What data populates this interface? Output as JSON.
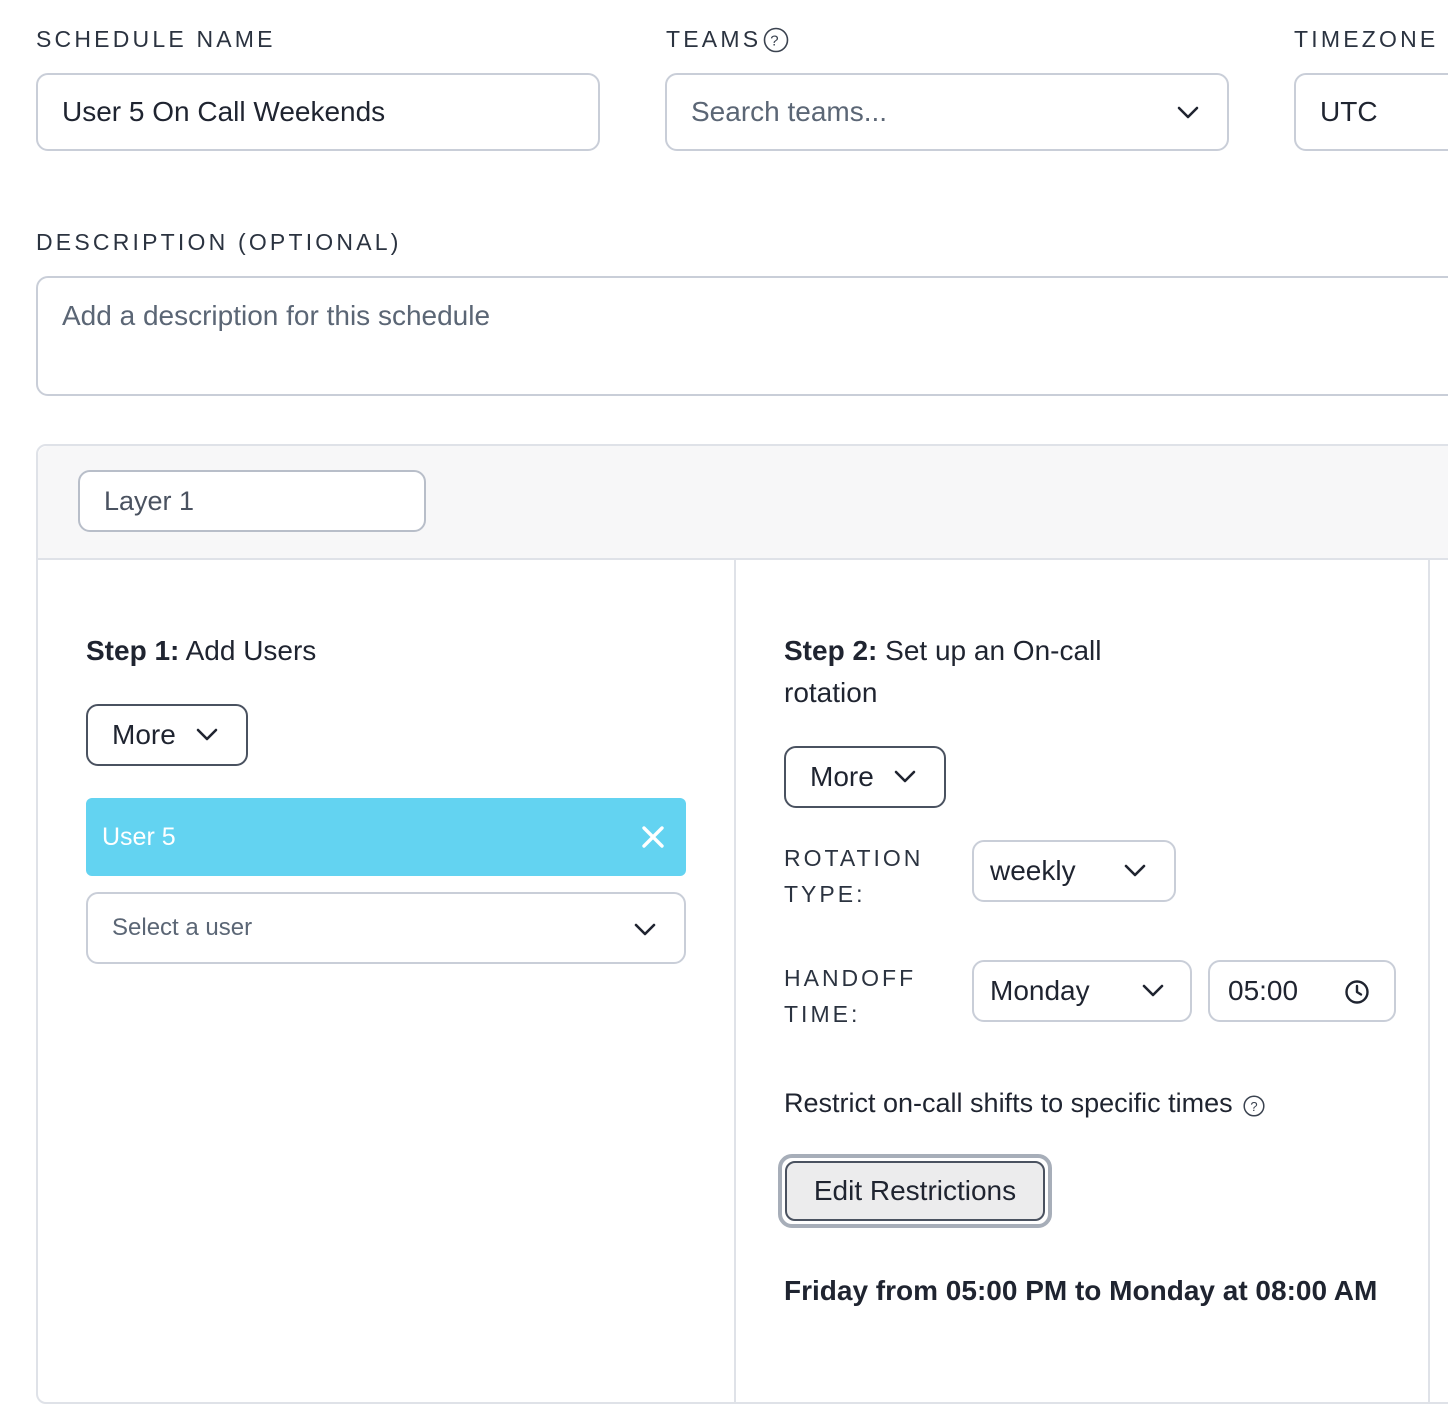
{
  "schedule_name": {
    "label": "SCHEDULE NAME",
    "value": "User 5 On Call Weekends"
  },
  "teams": {
    "label": "TEAMS",
    "placeholder": "Search teams..."
  },
  "timezone": {
    "label": "TIMEZONE",
    "value": "UTC"
  },
  "description": {
    "label": "DESCRIPTION (OPTIONAL)",
    "placeholder": "Add a description for this schedule"
  },
  "layer": {
    "name": "Layer 1"
  },
  "step1": {
    "title_bold": "Step 1:",
    "title_rest": " Add Users",
    "more_label": "More",
    "users": [
      {
        "name": "User 5"
      }
    ],
    "select_placeholder": "Select a user"
  },
  "step2": {
    "title_bold": "Step 2:",
    "title_rest": " Set up an On-call rotation",
    "more_label": "More",
    "rotation_type_label_1": "ROTATION",
    "rotation_type_label_2": "TYPE:",
    "rotation_type_value": "weekly",
    "handoff_label_1": "HANDOFF",
    "handoff_label_2": "TIME:",
    "handoff_day": "Monday",
    "handoff_time": "05:00",
    "restrict_label": "Restrict on-call shifts to specific times",
    "edit_restrictions_label": "Edit Restrictions",
    "restriction_summary": "Friday from 05:00 PM to Monday at 08:00 AM"
  },
  "icons": [
    "help-circle-icon",
    "chevron-down-icon",
    "close-icon",
    "clock-icon"
  ]
}
